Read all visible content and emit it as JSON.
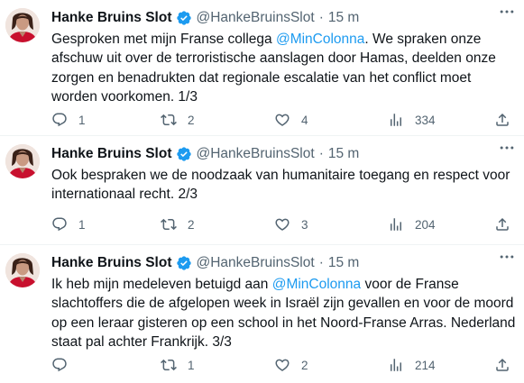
{
  "colors": {
    "accent": "#1d9bf0",
    "muted": "#536471",
    "text": "#0f1419",
    "verified": "#1d9bf0"
  },
  "tweets": [
    {
      "name": "Hanke Bruins Slot",
      "handle": "@HankeBruinsSlot",
      "separator": "·",
      "time": "15 m",
      "text_before": "Gesproken met mijn Franse collega ",
      "mention": "@MinColonna",
      "text_after": ". We spraken onze afschuw uit over de terroristische aanslagen door Hamas, deelden onze zorgen en benadrukten dat regionale escalatie van het conflict moet worden voorkomen. 1/3",
      "replies": "1",
      "retweets": "2",
      "likes": "4",
      "views": "334"
    },
    {
      "name": "Hanke Bruins Slot",
      "handle": "@HankeBruinsSlot",
      "separator": "·",
      "time": "15 m",
      "text_before": "Ook bespraken we de noodzaak van humanitaire toegang en respect voor internationaal recht. 2/3",
      "mention": "",
      "text_after": "",
      "replies": "1",
      "retweets": "2",
      "likes": "3",
      "views": "204"
    },
    {
      "name": "Hanke Bruins Slot",
      "handle": "@HankeBruinsSlot",
      "separator": "·",
      "time": "15 m",
      "text_before": "Ik heb mijn medeleven betuigd aan ",
      "mention": "@MinColonna",
      "text_after": " voor de Franse slachtoffers die de afgelopen week in Israël zijn gevallen en voor de moord op een leraar gisteren op een school in het Noord-Franse Arras. Nederland staat pal achter Frankrijk. 3/3",
      "replies": "",
      "retweets": "1",
      "likes": "2",
      "views": "214"
    }
  ]
}
